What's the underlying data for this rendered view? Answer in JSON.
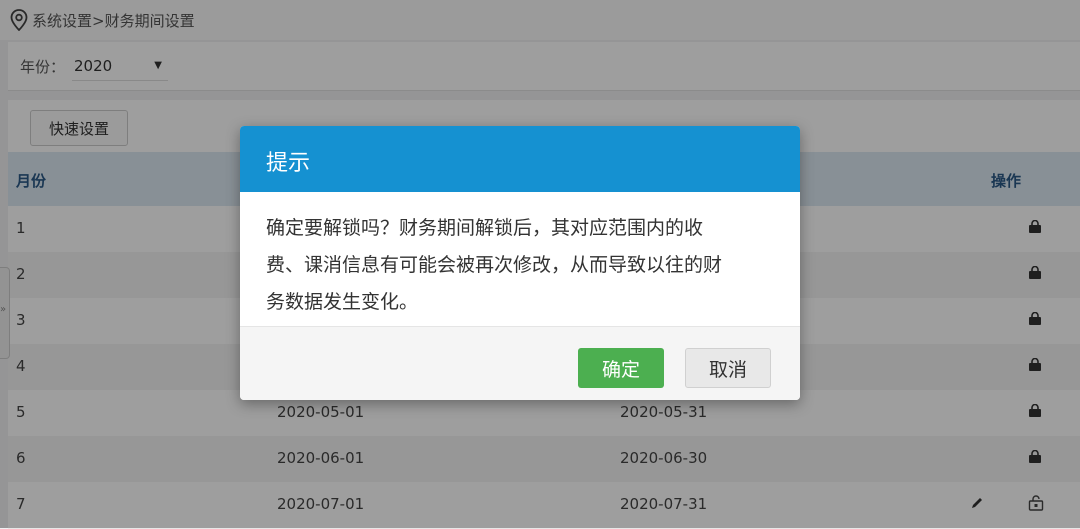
{
  "breadcrumb": {
    "text": "系统设置>财务期间设置"
  },
  "filter": {
    "year_label": "年份：",
    "year_value": "2020"
  },
  "toolbar": {
    "quick_setup_label": "快速设置"
  },
  "table": {
    "headers": {
      "month": "月份",
      "start": "",
      "end": "",
      "actions": "操作"
    },
    "rows": [
      {
        "month": "1",
        "start": "",
        "end": "",
        "locked": true
      },
      {
        "month": "2",
        "start": "",
        "end": "",
        "locked": true
      },
      {
        "month": "3",
        "start": "",
        "end": "",
        "locked": true
      },
      {
        "month": "4",
        "start": "",
        "end": "",
        "locked": true
      },
      {
        "month": "5",
        "start": "2020-05-01",
        "end": "2020-05-31",
        "locked": true
      },
      {
        "month": "6",
        "start": "2020-06-01",
        "end": "2020-06-30",
        "locked": true
      },
      {
        "month": "7",
        "start": "2020-07-01",
        "end": "2020-07-31",
        "locked": false
      }
    ]
  },
  "modal": {
    "title": "提示",
    "message_lines": [
      "确定要解锁吗？财务期间解锁后，其对应范围内的收",
      "费、课消信息有可能会被再次修改，从而导致以往的财",
      "务数据发生变化。"
    ],
    "ok_label": "确定",
    "cancel_label": "取消"
  },
  "icons": {
    "location": "location-pin-icon",
    "lock": "lock-icon",
    "unlock": "unlock-icon",
    "edit": "pencil-icon",
    "side_toggle": "chevron-right-icon"
  },
  "colors": {
    "header_blue": "#1591d1",
    "ok_green": "#4caf50",
    "table_header_bg": "#dce8f3"
  }
}
